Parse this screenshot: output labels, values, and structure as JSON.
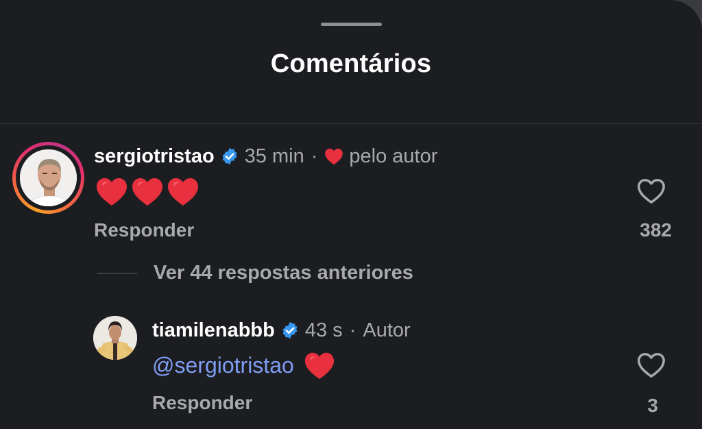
{
  "sheet": {
    "title": "Comentários"
  },
  "comment": {
    "username": "sergiotristao",
    "time": "35 min",
    "separator": "·",
    "liked_by_author": "pelo autor",
    "text_emoji": [
      "heart",
      "heart",
      "heart"
    ],
    "reply_label": "Responder",
    "like_count": "382"
  },
  "view_replies": {
    "label": "Ver 44 respostas anteriores"
  },
  "reply": {
    "username": "tiamilenabbb",
    "time": "43 s",
    "separator": "·",
    "role": "Autor",
    "mention": "@sergiotristao",
    "reply_label": "Responder",
    "like_count": "3"
  },
  "icons": {
    "verified": "verified-badge-icon",
    "heart_red": "heart-emoji-icon",
    "like": "heart-outline-icon"
  },
  "colors": {
    "background": "#1c1d21",
    "verified": "#3897f0",
    "heart": "#e8303e",
    "mention": "#7f9df3",
    "secondary_text": "#a8a9ae"
  }
}
